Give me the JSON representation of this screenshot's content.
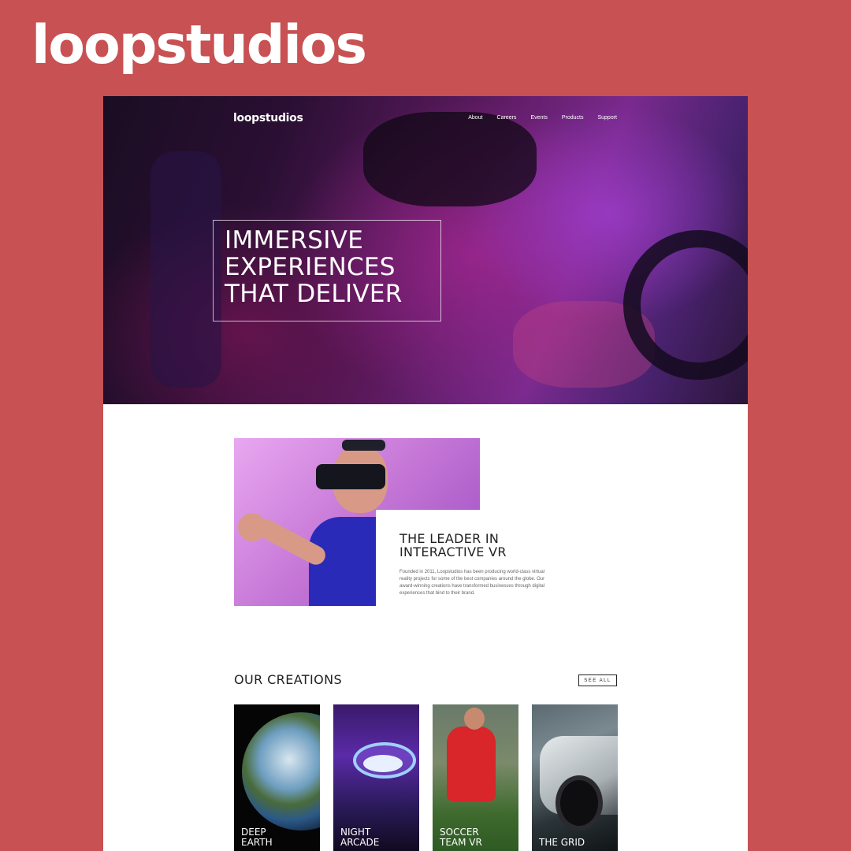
{
  "brand": {
    "logo_text": "loopstudios"
  },
  "site": {
    "nav_logo": "loopstudios",
    "nav": [
      "About",
      "Careers",
      "Events",
      "Products",
      "Support"
    ],
    "hero": {
      "title_lines": [
        "IMMERSIVE",
        "EXPERIENCES",
        "THAT DELIVER"
      ]
    },
    "about": {
      "title_lines": [
        "THE LEADER IN",
        "INTERACTIVE VR"
      ],
      "text": "Founded in 2011, Loopstudios has been producing world-class virtual reality projects for some of the best companies around the globe. Our award-winning creations have transformed businesses through digital experiences that bind to their brand."
    },
    "creations": {
      "title": "OUR CREATIONS",
      "see_all": "SEE ALL",
      "cards": [
        {
          "label_lines": [
            "DEEP",
            "EARTH"
          ]
        },
        {
          "label_lines": [
            "NIGHT",
            "ARCADE"
          ]
        },
        {
          "label_lines": [
            "SOCCER",
            "TEAM VR"
          ]
        },
        {
          "label_lines": [
            "THE GRID"
          ]
        }
      ]
    }
  },
  "colors": {
    "background": "#c85153",
    "page": "#ffffff",
    "text_dark": "#222222"
  }
}
